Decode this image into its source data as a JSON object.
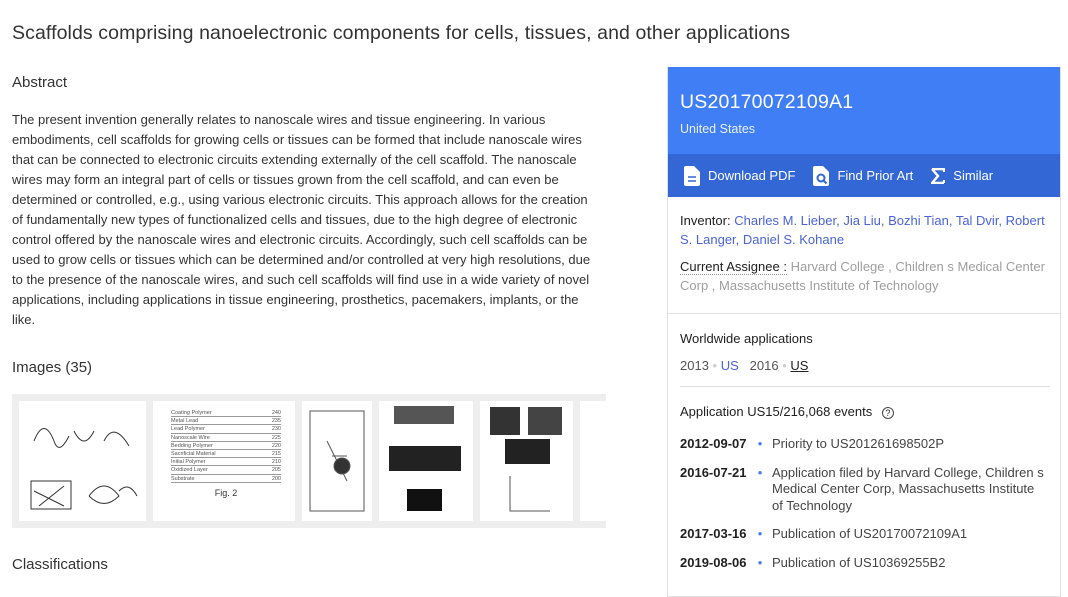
{
  "title": "Scaffolds comprising nanoelectronic components for cells, tissues, and other applications",
  "abstract": {
    "heading": "Abstract",
    "text": "The present invention generally relates to nanoscale wires and tissue engineering. In various embodiments, cell scaffolds for growing cells or tissues can be formed that include nanoscale wires that can be connected to electronic circuits extending externally of the cell scaffold. The nanoscale wires may form an integral part of cells or tissues grown from the cell scaffold, and can even be determined or controlled, e.g., using various electronic circuits. This approach allows for the creation of fundamentally new types of functionalized cells and tissues, due to the high degree of electronic control offered by the nanoscale wires and electronic circuits. Accordingly, such cell scaffolds can be used to grow cells or tissues which can be determined and/or controlled at very high resolutions, due to the presence of the nanoscale wires, and such cell scaffolds will find use in a wide variety of novel applications, including applications in tissue engineering, prosthetics, pacemakers, implants, or the like."
  },
  "images": {
    "heading": "Images (35)",
    "fig2": {
      "rows": [
        [
          "Coating Polymer",
          "240"
        ],
        [
          "Metal Lead",
          "235"
        ],
        [
          "Lead Polymer",
          "230"
        ],
        [
          "Nanoscale Wire",
          "225"
        ],
        [
          "Bedding Polymer",
          "220"
        ],
        [
          "Sacrificial Material",
          "215"
        ],
        [
          "Initial Polymer",
          "210"
        ],
        [
          "Oxidized Layer",
          "205"
        ],
        [
          "Substrate",
          "200"
        ]
      ],
      "caption": "Fig. 2"
    }
  },
  "classifications": {
    "heading": "Classifications"
  },
  "panel": {
    "number": "US20170072109A1",
    "country": "United States",
    "actions": [
      {
        "label": "Download PDF",
        "icon": "document-icon"
      },
      {
        "label": "Find Prior Art",
        "icon": "search-document-icon"
      },
      {
        "label": "Similar",
        "icon": "sigma-icon"
      }
    ],
    "inventor_label": "Inventor:",
    "inventors": "Charles M. Lieber, Jia Liu, Bozhi Tian, Tal Dvir, Robert S. Langer, Daniel S. Kohane",
    "assignee_label": "Current Assignee :",
    "assignee": "Harvard College , Children s Medical Center Corp , Massachusetts Institute of Technology",
    "worldwide": {
      "heading": "Worldwide applications",
      "items": [
        {
          "year": "2013",
          "country": "US"
        },
        {
          "year": "2016",
          "country": "US"
        }
      ]
    },
    "events": {
      "heading": "Application US15/216,068 events",
      "items": [
        {
          "date": "2012-09-07",
          "text": "Priority to US201261698502P"
        },
        {
          "date": "2016-07-21",
          "text": "Application filed by Harvard College, Children s Medical Center Corp, Massachusetts Institute of Technology"
        },
        {
          "date": "2017-03-16",
          "text": "Publication of US20170072109A1"
        },
        {
          "date": "2019-08-06",
          "text": "Publication of US10369255B2"
        }
      ]
    }
  },
  "colors": {
    "header": "#3f7ef5",
    "actionbar": "#3367d6",
    "link": "#4a63d8"
  }
}
